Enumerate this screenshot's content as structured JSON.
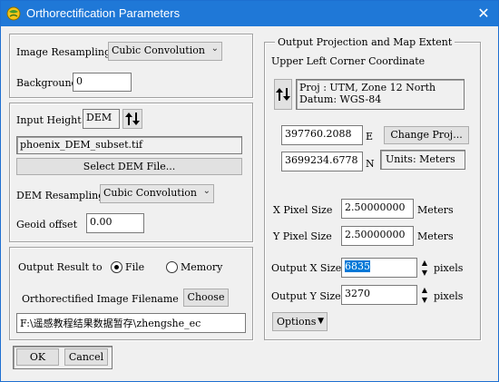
{
  "window": {
    "title": "Orthorectification Parameters"
  },
  "resampling": {
    "image_resampling_label": "Image Resampling",
    "image_resampling_value": "Cubic Convolution",
    "background_label": "Background",
    "background_value": "0"
  },
  "dem": {
    "input_height_label": "Input Height",
    "input_height_value": "DEM",
    "dem_file": "phoenix_DEM_subset.tif",
    "select_dem_label": "Select DEM File...",
    "dem_resampling_label": "DEM Resampling",
    "dem_resampling_value": "Cubic Convolution",
    "geoid_label": "Geoid offset",
    "geoid_value": "0.00"
  },
  "output": {
    "result_to_label": "Output Result to",
    "file_label": "File",
    "memory_label": "Memory",
    "selected": "File",
    "filename_label": "Orthorectified Image Filename",
    "choose_label": "Choose",
    "filename_value": "F:\\遥感教程结果数据暂存\\zhengshe_ec"
  },
  "projection": {
    "group_title": "Output Projection and Map Extent",
    "ulc_label": "Upper Left Corner Coordinate",
    "proj_line1": "Proj : UTM, Zone 12 North",
    "proj_line2": "Datum: WGS-84",
    "easting_value": "397760.2088",
    "easting_unit": "E",
    "northing_value": "3699234.6778",
    "northing_unit": "N",
    "change_proj_label": "Change Proj...",
    "units_label": "Units: Meters",
    "x_pixel_size_label": "X Pixel Size",
    "x_pixel_size_value": "2.50000000",
    "x_pixel_size_unit": "Meters",
    "y_pixel_size_label": "Y Pixel Size",
    "y_pixel_size_value": "2.50000000",
    "y_pixel_size_unit": "Meters",
    "out_x_label": "Output X Size",
    "out_x_value": "6835",
    "out_x_unit": "pixels",
    "out_y_label": "Output Y Size",
    "out_y_value": "3270",
    "out_y_unit": "pixels",
    "options_label": "Options"
  },
  "buttons": {
    "ok_label": "OK",
    "cancel_label": "Cancel"
  },
  "icons": {
    "app": "envi-globe-icon",
    "close": "close-icon",
    "swap": "up-down-arrows-icon",
    "combo_arrow": "chevron-down-icon",
    "spin": "spinner-arrows-icon"
  },
  "colors": {
    "titlebar": "#1f78d7",
    "selection": "#0078d7",
    "panel": "#f0f0f0"
  }
}
